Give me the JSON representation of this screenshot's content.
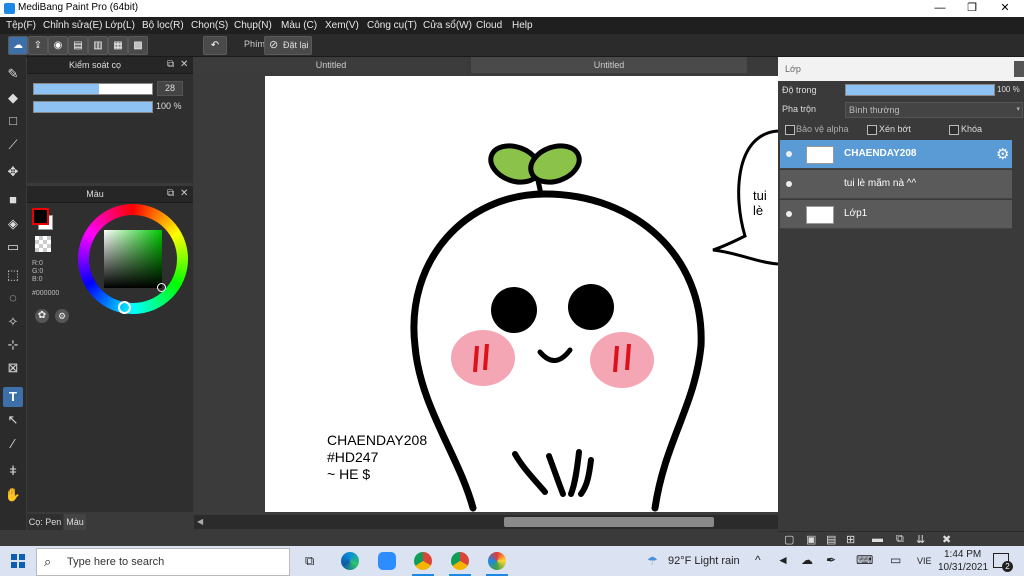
{
  "window": {
    "title": "MediBang Paint Pro (64bit)",
    "controls": [
      "—",
      "❐",
      "✕"
    ]
  },
  "menu": [
    "Tệp(F)",
    "Chỉnh sửa(E)",
    "Lớp(L)",
    "Bộ lọc(R)",
    "Chọn(S)",
    "Chụp(N)",
    "Màu (C)",
    "Xem(V)",
    "Công cụ(T)",
    "Cửa sổ(W)",
    "Cloud",
    "Help"
  ],
  "toolbar": {
    "phim_label": "Phím",
    "reset_label": "Đặt lại"
  },
  "brush_panel": {
    "title": "Kiểm soát cọ",
    "size_value": "28",
    "size_fraction": 0.55,
    "opacity_value": "100 %",
    "opacity_fraction": 1.0
  },
  "color_panel": {
    "title": "Màu",
    "r": "R:0",
    "g": "G:0",
    "b": "B:0",
    "hex": "#000000",
    "foreground": "#000000",
    "background": "#ffffff"
  },
  "bottom_tabs": [
    "Cọ: Pen",
    "Màu"
  ],
  "doc_tabs": [
    "Untitled",
    "Untitled"
  ],
  "canvas": {
    "text_lines": [
      "CHAENDAY208",
      "#HD247",
      "~ HE $"
    ],
    "bubble_text": "tui lè"
  },
  "layers_panel": {
    "title": "Lớp",
    "opacity_label": "Độ trong",
    "opacity_value": "100 %",
    "opacity_fraction": 1.0,
    "blend_label": "Pha trộn",
    "blend_value": "Bình thường",
    "options": [
      "Bảo vệ alpha",
      "Xén bớt",
      "Khóa"
    ],
    "layers": [
      {
        "name": "CHAENDAY208",
        "selected": true
      },
      {
        "name": "tui lè mãm nà ^^",
        "selected": false
      },
      {
        "name": "Lớp1",
        "selected": false
      }
    ]
  },
  "taskbar": {
    "search_placeholder": "Type here to search",
    "weather": "92°F  Light rain",
    "language": "VIE",
    "time": "1:44 PM",
    "date": "10/31/2021",
    "notification_count": "2"
  },
  "colors": {
    "accent": "#5b9bd5",
    "menubar": "#1f1f1f",
    "cheek": "#f4a6b4",
    "cheek_mark": "#e0101a",
    "sprout": "#8bc34a"
  }
}
